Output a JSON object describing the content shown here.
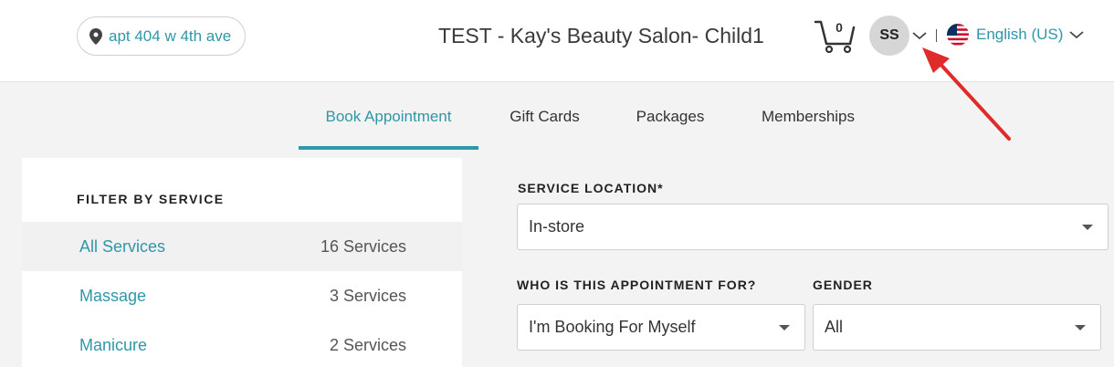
{
  "header": {
    "location": "apt 404 w 4th ave",
    "salon_title": "TEST - Kay's Beauty Salon- Child1",
    "cart_count": "0",
    "user_initials": "SS",
    "language": "English (US)"
  },
  "tabs": [
    {
      "label": "Book Appointment",
      "active": true
    },
    {
      "label": "Gift Cards",
      "active": false
    },
    {
      "label": "Packages",
      "active": false
    },
    {
      "label": "Memberships",
      "active": false
    }
  ],
  "filter": {
    "heading": "FILTER BY SERVICE",
    "items": [
      {
        "name": "All Services",
        "count": "16 Services",
        "selected": true
      },
      {
        "name": "Massage",
        "count": "3 Services",
        "selected": false
      },
      {
        "name": "Manicure",
        "count": "2 Services",
        "selected": false
      }
    ]
  },
  "form": {
    "service_location_label": "SERVICE LOCATION*",
    "service_location_value": "In-store",
    "who_label": "WHO IS THIS APPOINTMENT FOR?",
    "who_value": "I'm Booking For Myself",
    "gender_label": "GENDER",
    "gender_value": "All"
  },
  "colors": {
    "accent": "#2e97a8",
    "annotation_arrow": "#e02b2b"
  },
  "icons": {
    "location": "map-pin-icon",
    "cart": "shopping-cart-icon",
    "chevron": "chevron-down-icon",
    "flag": "us-flag-icon"
  }
}
